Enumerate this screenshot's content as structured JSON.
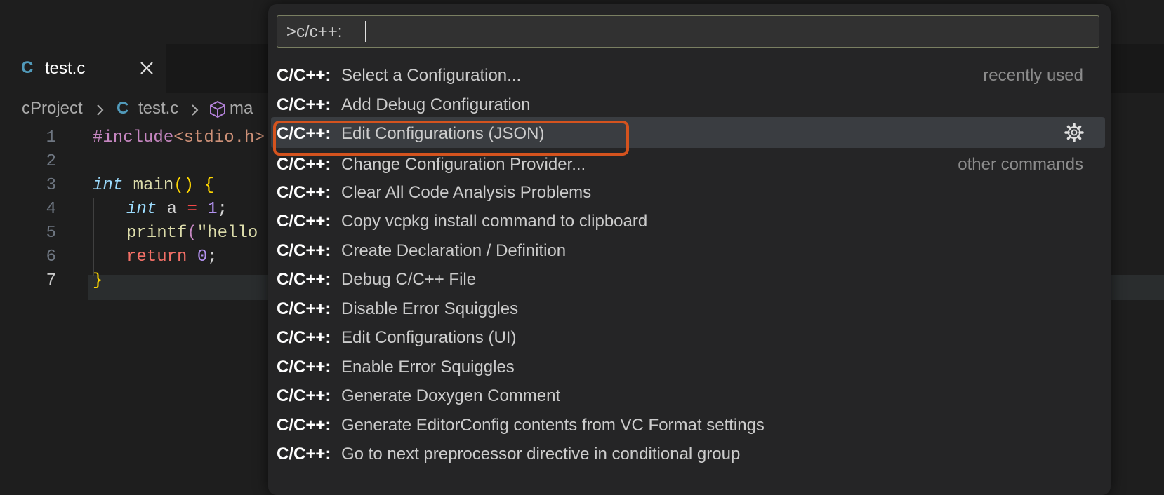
{
  "editor": {
    "tab": {
      "icon": "C",
      "name": "test.c",
      "close_icon": "close-icon"
    },
    "breadcrumb": {
      "folder": "cProject",
      "file_icon": "C",
      "file": "test.c",
      "symbol": "ma"
    },
    "lines": [
      {
        "n": "1"
      },
      {
        "n": "2"
      },
      {
        "n": "3"
      },
      {
        "n": "4"
      },
      {
        "n": "5"
      },
      {
        "n": "6"
      },
      {
        "n": "7"
      }
    ],
    "code": {
      "l1_pre": "#include",
      "l1_inc": "<stdio.h>",
      "l3_type": "int",
      "l3_fn": " main",
      "l3_paren": "()",
      "l3_brace": " {",
      "l4_type": "int",
      "l4_var": " a ",
      "l4_op": "=",
      "l4_num": " 1",
      "l4_semi": ";",
      "l5_fn": "printf",
      "l5_paren": "(",
      "l5_str": "\"hello",
      "l6_ret": "return",
      "l6_num": " 0",
      "l6_semi": ";",
      "l7_brace": "}"
    }
  },
  "palette": {
    "input_value": ">c/c++:",
    "prefix": "C/C++:",
    "items": [
      {
        "label": "Select a Configuration...",
        "hint": "recently used"
      },
      {
        "label": "Add Debug Configuration",
        "hint": ""
      },
      {
        "label": "Edit Configurations (JSON)",
        "hint": "",
        "selected": true,
        "icon": "gear-icon"
      },
      {
        "label": "Change Configuration Provider...",
        "hint": "other commands"
      },
      {
        "label": "Clear All Code Analysis Problems",
        "hint": ""
      },
      {
        "label": "Copy vcpkg install command to clipboard",
        "hint": ""
      },
      {
        "label": "Create Declaration / Definition",
        "hint": ""
      },
      {
        "label": "Debug C/C++ File",
        "hint": ""
      },
      {
        "label": "Disable Error Squiggles",
        "hint": ""
      },
      {
        "label": "Edit Configurations (UI)",
        "hint": ""
      },
      {
        "label": "Enable Error Squiggles",
        "hint": ""
      },
      {
        "label": "Generate Doxygen Comment",
        "hint": ""
      },
      {
        "label": "Generate EditorConfig contents from VC Format settings",
        "hint": ""
      },
      {
        "label": "Go to next preprocessor directive in conditional group",
        "hint": ""
      }
    ],
    "colors": {
      "highlight_border": "#d4531e",
      "selected_bg": "#3a3d41"
    }
  }
}
